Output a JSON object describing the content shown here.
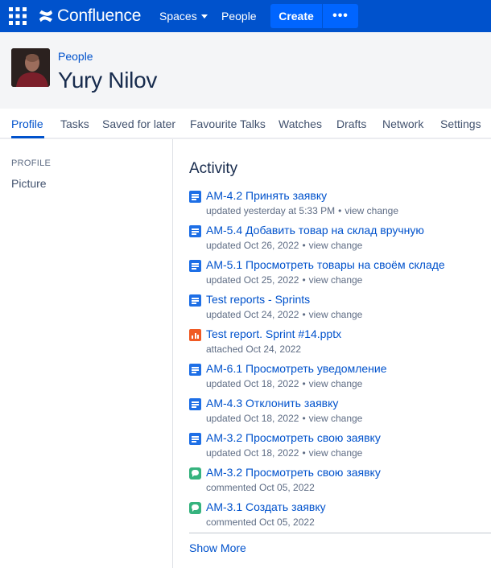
{
  "topnav": {
    "logo_text": "Confluence",
    "spaces_label": "Spaces",
    "people_label": "People",
    "create_label": "Create",
    "more_label": "•••",
    "brand_color": "#0052cc"
  },
  "profile": {
    "breadcrumb": "People",
    "name": "Yury Nilov"
  },
  "tabs": [
    {
      "label": "Profile"
    },
    {
      "label": "Tasks"
    },
    {
      "label": "Saved for later"
    },
    {
      "label": "Favourite Talks"
    },
    {
      "label": "Watches"
    },
    {
      "label": "Drafts"
    },
    {
      "label": "Network"
    },
    {
      "label": "Settings"
    }
  ],
  "sidebar": {
    "heading": "PROFILE",
    "items": [
      {
        "label": "Picture"
      }
    ]
  },
  "activity": {
    "title": "Activity",
    "items": [
      {
        "icon": "page-icon",
        "title": "AM-4.2 Принять заявку",
        "meta": "updated yesterday at 5:33 PM",
        "action": "view change"
      },
      {
        "icon": "page-icon",
        "title": "AM-5.4 Добавить товар на склад вручную",
        "meta": "updated Oct 26, 2022",
        "action": "view change"
      },
      {
        "icon": "page-icon",
        "title": "AM-5.1 Просмотреть товары на своём складе",
        "meta": "updated Oct 25, 2022",
        "action": "view change"
      },
      {
        "icon": "page-icon",
        "title": "Test reports - Sprints",
        "meta": "updated Oct 24, 2022",
        "action": "view change"
      },
      {
        "icon": "powerpoint-file-icon",
        "title": "Test report. Sprint #14.pptx",
        "meta": "attached Oct 24, 2022",
        "action": ""
      },
      {
        "icon": "page-icon",
        "title": "AM-6.1 Просмотреть уведомление",
        "meta": "updated Oct 18, 2022",
        "action": "view change"
      },
      {
        "icon": "page-icon",
        "title": "AM-4.3 Отклонить заявку",
        "meta": "updated Oct 18, 2022",
        "action": "view change"
      },
      {
        "icon": "page-icon",
        "title": "AM-3.2 Просмотреть свою заявку",
        "meta": "updated Oct 18, 2022",
        "action": "view change"
      },
      {
        "icon": "comment-icon",
        "title": "AM-3.2 Просмотреть свою заявку",
        "meta": "commented Oct 05, 2022",
        "action": ""
      },
      {
        "icon": "comment-icon",
        "title": "AM-3.1 Создать заявку",
        "meta": "commented Oct 05, 2022",
        "action": ""
      }
    ],
    "show_more": "Show More"
  }
}
